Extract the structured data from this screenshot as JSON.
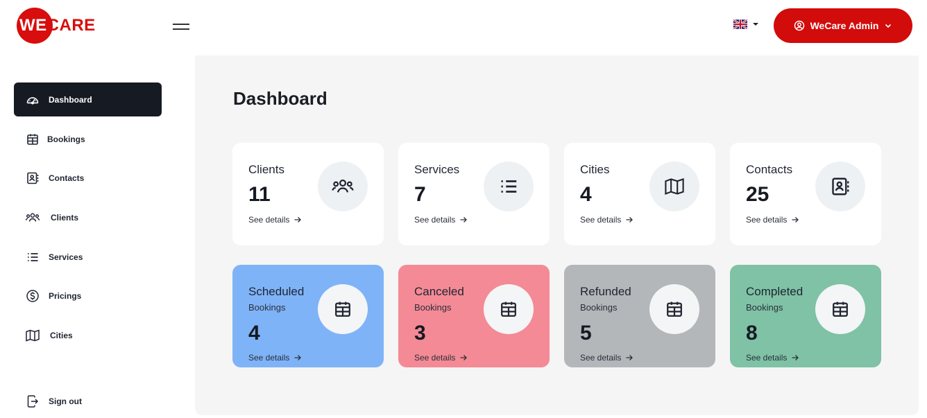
{
  "brand": {
    "name_part1": "WE",
    "name_part2": "CARE",
    "primary_color": "#d20b0b"
  },
  "header": {
    "language_icon": "uk-flag-icon",
    "user_button_label": "WeCare Admin"
  },
  "sidebar": {
    "items": [
      {
        "label": "Dashboard",
        "icon": "speedometer-icon",
        "active": true
      },
      {
        "label": "Bookings",
        "icon": "calendar-icon",
        "active": false
      },
      {
        "label": "Contacts",
        "icon": "contact-book-icon",
        "active": false
      },
      {
        "label": "Clients",
        "icon": "users-icon",
        "active": false
      },
      {
        "label": "Services",
        "icon": "list-icon",
        "active": false
      },
      {
        "label": "Pricings",
        "icon": "dollar-icon",
        "active": false
      },
      {
        "label": "Cities",
        "icon": "map-icon",
        "active": false
      }
    ],
    "sign_out_label": "Sign out"
  },
  "main": {
    "title": "Dashboard",
    "stats": [
      {
        "title": "Clients",
        "value": "11",
        "link": "See details",
        "icon": "users-icon"
      },
      {
        "title": "Services",
        "value": "7",
        "link": "See details",
        "icon": "list-icon"
      },
      {
        "title": "Cities",
        "value": "4",
        "link": "See details",
        "icon": "map-icon"
      },
      {
        "title": "Contacts",
        "value": "25",
        "link": "See details",
        "icon": "contact-book-icon"
      }
    ],
    "bookings": [
      {
        "title": "Scheduled",
        "subtitle": "Bookings",
        "value": "4",
        "link": "See details",
        "icon": "calendar-icon",
        "color": "#7fb3f8"
      },
      {
        "title": "Canceled",
        "subtitle": "Bookings",
        "value": "3",
        "link": "See details",
        "icon": "calendar-icon",
        "color": "#f48a95"
      },
      {
        "title": "Refunded",
        "subtitle": "Bookings",
        "value": "5",
        "link": "See details",
        "icon": "calendar-icon",
        "color": "#b3b7ba"
      },
      {
        "title": "Completed",
        "subtitle": "Bookings",
        "value": "8",
        "link": "See details",
        "icon": "calendar-icon",
        "color": "#7fc2a6"
      }
    ]
  }
}
